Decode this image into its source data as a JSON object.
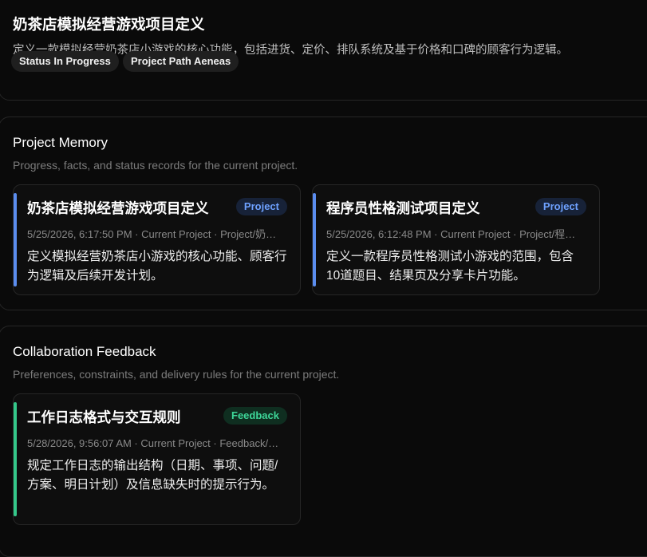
{
  "header": {
    "title": "奶茶店模拟经营游戏项目定义",
    "description": "定义一款模拟经营奶茶店小游戏的核心功能，包括进货、定价、排队系统及基于价格和口碑的顾客行为逻辑。",
    "tags": [
      "Status In Progress",
      "Project Path Aeneas"
    ]
  },
  "memory": {
    "title": "Project Memory",
    "subtitle": "Progress, facts, and status records for the current project.",
    "cards": [
      {
        "title": "奶茶店模拟经营游戏项目定义",
        "badge": "Project",
        "meta": "5/25/2026, 6:17:50 PM · Current Project · Project/奶茶店模拟经营游戏项目定义",
        "body": "定义模拟经营奶茶店小游戏的核心功能、顾客行为逻辑及后续开发计划。"
      },
      {
        "title": "程序员性格测试项目定义",
        "badge": "Project",
        "meta": "5/25/2026, 6:12:48 PM · Current Project · Project/程序员性格测试项目定义",
        "body": "定义一款程序员性格测试小游戏的范围，包含10道题目、结果页及分享卡片功能。"
      }
    ]
  },
  "feedback": {
    "title": "Collaboration Feedback",
    "subtitle": "Preferences, constraints, and delivery rules for the current project.",
    "cards": [
      {
        "title": "工作日志格式与交互规则",
        "badge": "Feedback",
        "meta": "5/28/2026, 9:56:07 AM · Current Project · Feedback/工作日志格式与交互规则",
        "body": "规定工作日志的输出结构（日期、事项、问题/方案、明日计划）及信息缺失时的提示行为。"
      }
    ]
  },
  "colors": {
    "background": "#0a0a0a",
    "project_accent": "#5b8def",
    "project_badge_text": "#6ea1ff",
    "feedback_accent": "#34c88a",
    "feedback_badge_text": "#3ed699"
  }
}
